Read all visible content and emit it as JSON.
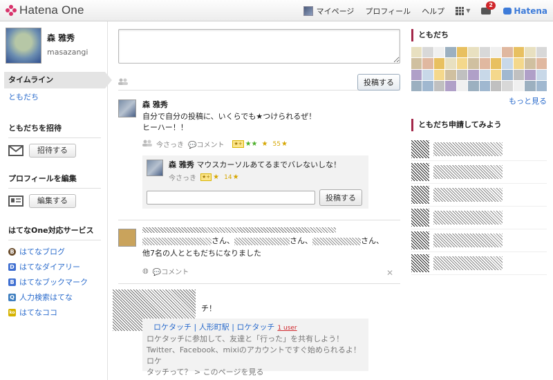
{
  "header": {
    "brand": "Hatena One",
    "nav": {
      "mypage": "マイページ",
      "profile": "プロフィール",
      "help": "ヘルプ",
      "notification_count": "2",
      "hatena": "Hatena"
    }
  },
  "user": {
    "name": "森 雅秀",
    "id": "masazangi"
  },
  "sidebar": {
    "timeline": "タイムライン",
    "friends_link": "ともだち",
    "invite": {
      "title": "ともだちを招待",
      "button": "招待する"
    },
    "edit_profile": {
      "title": "プロフィールを編集",
      "button": "編集する"
    },
    "services": {
      "title": "はてなOne対応サービス",
      "items": [
        {
          "label": "はてなブログ",
          "icon_color": "#6b4e2e",
          "icon": "B"
        },
        {
          "label": "はてなダイアリー",
          "icon_color": "#3f6fd1",
          "icon": "D"
        },
        {
          "label": "はてなブックマーク",
          "icon_color": "#3f6fd1",
          "icon": "B"
        },
        {
          "label": "人力検索はてな",
          "icon_color": "#3f7fc0",
          "icon": "Q"
        },
        {
          "label": "はてなココ",
          "icon_color": "#d6b300",
          "icon": "ko"
        }
      ]
    }
  },
  "composer": {
    "post_button": "投稿する"
  },
  "timeline": {
    "entry1": {
      "author": "森 雅秀",
      "text_line1": "自分で自分の投稿に、いくらでも★つけられるぜ！",
      "text_line2": "ヒーハー！！",
      "time": "今さっき",
      "comment": "コメント",
      "star_count": "55",
      "reply": {
        "author": "森 雅秀",
        "text": "マウスカーソルあてるまでバレないしな！",
        "time": "今さっき",
        "star_count": "14"
      },
      "reply_button": "投稿する"
    },
    "entry2": {
      "line1_suffix1": "さん、",
      "line1_suffix2": "さん、",
      "line1_suffix3": "さん、",
      "line2": "他7名の人とともだちになりました",
      "comment": "コメント"
    },
    "entry3": {
      "text_tail": "チ！",
      "link_title": "ロケタッチ | 人形町駅 | ロケタッチ",
      "users": "1 user",
      "desc1": "ロケタッチに参加して、友達と「行った」を共有しよう！",
      "desc2": "Twitter、Facebook、mixiのアカウントですぐ始められるよ！ ロケ",
      "desc3": "タッチって？ > このページを見る"
    }
  },
  "right": {
    "friends_title": "ともだち",
    "more": "もっと見る",
    "suggest_title": "ともだち申請してみよう"
  }
}
